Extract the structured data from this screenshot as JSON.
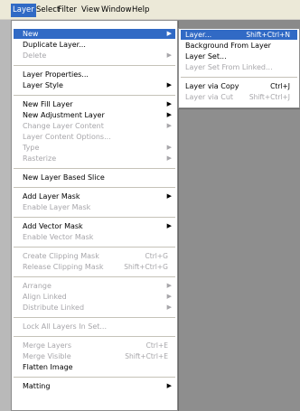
{
  "menubar": {
    "items": [
      "Layer",
      "Select",
      "Filter",
      "View",
      "Window",
      "Help"
    ]
  },
  "main_menu": {
    "new": "New",
    "duplicate_layer": "Duplicate Layer...",
    "delete": "Delete",
    "layer_properties": "Layer Properties...",
    "layer_style": "Layer Style",
    "new_fill_layer": "New Fill Layer",
    "new_adjustment_layer": "New Adjustment Layer",
    "change_layer_content": "Change Layer Content",
    "layer_content_options": "Layer Content Options...",
    "type": "Type",
    "rasterize": "Rasterize",
    "new_layer_based_slice": "New Layer Based Slice",
    "add_layer_mask": "Add Layer Mask",
    "enable_layer_mask": "Enable Layer Mask",
    "add_vector_mask": "Add Vector Mask",
    "enable_vector_mask": "Enable Vector Mask",
    "create_clipping_mask": "Create Clipping Mask",
    "create_clipping_mask_shortcut": "Ctrl+G",
    "release_clipping_mask": "Release Clipping Mask",
    "release_clipping_mask_shortcut": "Shift+Ctrl+G",
    "arrange": "Arrange",
    "align_linked": "Align Linked",
    "distribute_linked": "Distribute Linked",
    "lock_all_layers": "Lock All Layers In Set...",
    "merge_layers": "Merge Layers",
    "merge_layers_shortcut": "Ctrl+E",
    "merge_visible": "Merge Visible",
    "merge_visible_shortcut": "Shift+Ctrl+E",
    "flatten_image": "Flatten Image",
    "matting": "Matting"
  },
  "sub_menu": {
    "layer": "Layer...",
    "layer_shortcut": "Shift+Ctrl+N",
    "background_from_layer": "Background From Layer",
    "layer_set": "Layer Set...",
    "layer_set_from_linked": "Layer Set From Linked...",
    "layer_via_copy": "Layer via Copy",
    "layer_via_copy_shortcut": "Ctrl+J",
    "layer_via_cut": "Layer via Cut",
    "layer_via_cut_shortcut": "Shift+Ctrl+J"
  },
  "glyphs": {
    "submenu_arrow": "▶"
  },
  "colors": {
    "highlight": "#316ac5",
    "disabled_text": "#a7a6aa",
    "menu_bg": "#ffffff"
  }
}
